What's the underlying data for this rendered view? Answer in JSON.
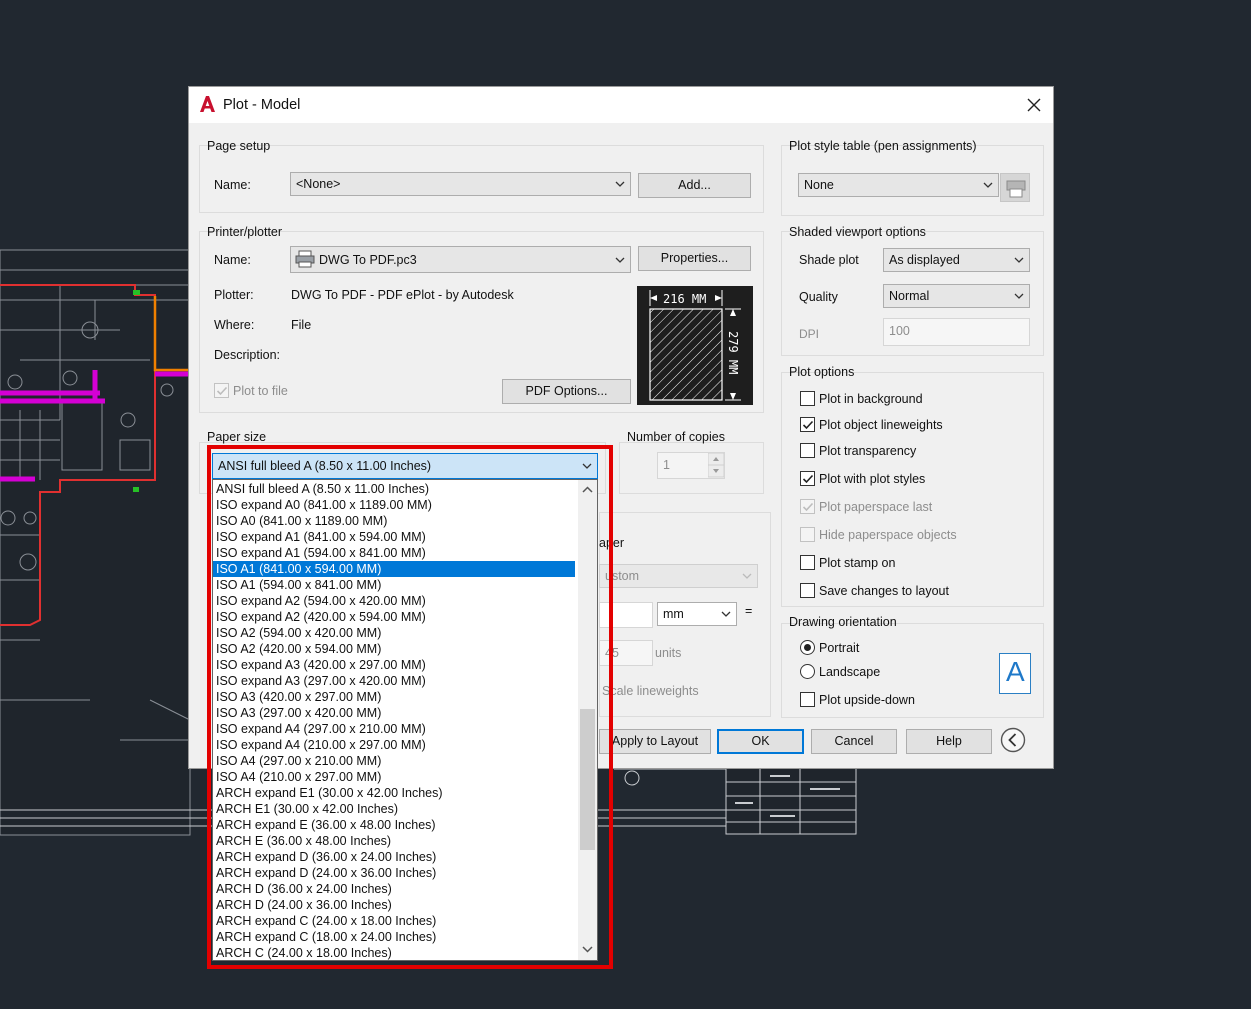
{
  "dialog": {
    "title": "Plot - Model",
    "page_setup": {
      "label": "Page setup",
      "name_label": "Name:",
      "name_value": "<None>",
      "add_button": "Add..."
    },
    "printer": {
      "label": "Printer/plotter",
      "name_label": "Name:",
      "name_value": "DWG To PDF.pc3",
      "properties_button": "Properties...",
      "plotter_label": "Plotter:",
      "plotter_value": "DWG To PDF - PDF ePlot - by Autodesk",
      "where_label": "Where:",
      "where_value": "File",
      "description_label": "Description:",
      "plot_to_file_label": "Plot to file",
      "plot_to_file_checked": true,
      "pdf_options_button": "PDF Options...",
      "preview_width": "216 MM",
      "preview_height": "279 MM"
    },
    "paper_size": {
      "label": "Paper size",
      "selected": "ANSI full bleed A (8.50 x 11.00 Inches)"
    },
    "copies": {
      "label": "Number of copies",
      "value": "1"
    },
    "plot_area_fragments": {
      "paper_label": "aper",
      "custom_value": "ustom",
      "unit_value": "mm",
      "equals": "=",
      "scale_fragment": "45",
      "units_label": "units",
      "scale_lineweights_label": "Scale lineweights"
    },
    "plot_style_table": {
      "label": "Plot style table (pen assignments)",
      "value": "None"
    },
    "shaded_viewport": {
      "label": "Shaded viewport options",
      "shade_plot_label": "Shade plot",
      "shade_plot_value": "As displayed",
      "quality_label": "Quality",
      "quality_value": "Normal",
      "dpi_label": "DPI",
      "dpi_value": "100"
    },
    "plot_options": {
      "label": "Plot options",
      "items": [
        {
          "label": "Plot in background",
          "checked": false,
          "enabled": true
        },
        {
          "label": "Plot object lineweights",
          "checked": true,
          "enabled": true
        },
        {
          "label": "Plot transparency",
          "checked": false,
          "enabled": true
        },
        {
          "label": "Plot with plot styles",
          "checked": true,
          "enabled": true
        },
        {
          "label": "Plot paperspace last",
          "checked": true,
          "enabled": false
        },
        {
          "label": "Hide paperspace objects",
          "checked": false,
          "enabled": false
        },
        {
          "label": "Plot stamp on",
          "checked": false,
          "enabled": true
        },
        {
          "label": "Save changes to layout",
          "checked": false,
          "enabled": true
        }
      ]
    },
    "orientation": {
      "label": "Drawing orientation",
      "portrait_label": "Portrait",
      "landscape_label": "Landscape",
      "selected": "Portrait",
      "upside_down_label": "Plot upside-down",
      "upside_down_checked": false,
      "orientation_glyph": "A"
    },
    "buttons": {
      "apply": "Apply to Layout",
      "ok": "OK",
      "cancel": "Cancel",
      "help": "Help"
    }
  },
  "paper_list": {
    "selected_index": 5,
    "items": [
      "ANSI full bleed A (8.50 x 11.00 Inches)",
      "ISO expand A0 (841.00 x 1189.00 MM)",
      "ISO A0 (841.00 x 1189.00 MM)",
      "ISO expand A1 (841.00 x 594.00 MM)",
      "ISO expand A1 (594.00 x 841.00 MM)",
      "ISO A1 (841.00 x 594.00 MM)",
      "ISO A1 (594.00 x 841.00 MM)",
      "ISO expand A2 (594.00 x 420.00 MM)",
      "ISO expand A2 (420.00 x 594.00 MM)",
      "ISO A2 (594.00 x 420.00 MM)",
      "ISO A2 (420.00 x 594.00 MM)",
      "ISO expand A3 (420.00 x 297.00 MM)",
      "ISO expand A3 (297.00 x 420.00 MM)",
      "ISO A3 (420.00 x 297.00 MM)",
      "ISO A3 (297.00 x 420.00 MM)",
      "ISO expand A4 (297.00 x 210.00 MM)",
      "ISO expand A4 (210.00 x 297.00 MM)",
      "ISO A4 (297.00 x 210.00 MM)",
      "ISO A4 (210.00 x 297.00 MM)",
      "ARCH expand E1 (30.00 x 42.00 Inches)",
      "ARCH E1 (30.00 x 42.00 Inches)",
      "ARCH expand E (36.00 x 48.00 Inches)",
      "ARCH E (36.00 x 48.00 Inches)",
      "ARCH expand D (36.00 x 24.00 Inches)",
      "ARCH expand D (24.00 x 36.00 Inches)",
      "ARCH D (36.00 x 24.00 Inches)",
      "ARCH D (24.00 x 36.00 Inches)",
      "ARCH expand C (24.00 x 18.00 Inches)",
      "ARCH expand C (18.00 x 24.00 Inches)",
      "ARCH C (24.00 x 18.00 Inches)"
    ]
  },
  "colors": {
    "background": "#212830",
    "accent": "#0078d7",
    "highlight_box": "#e30000",
    "cad_magenta": "#d400d4",
    "cad_red": "#e03030",
    "cad_orange": "#f08000"
  }
}
